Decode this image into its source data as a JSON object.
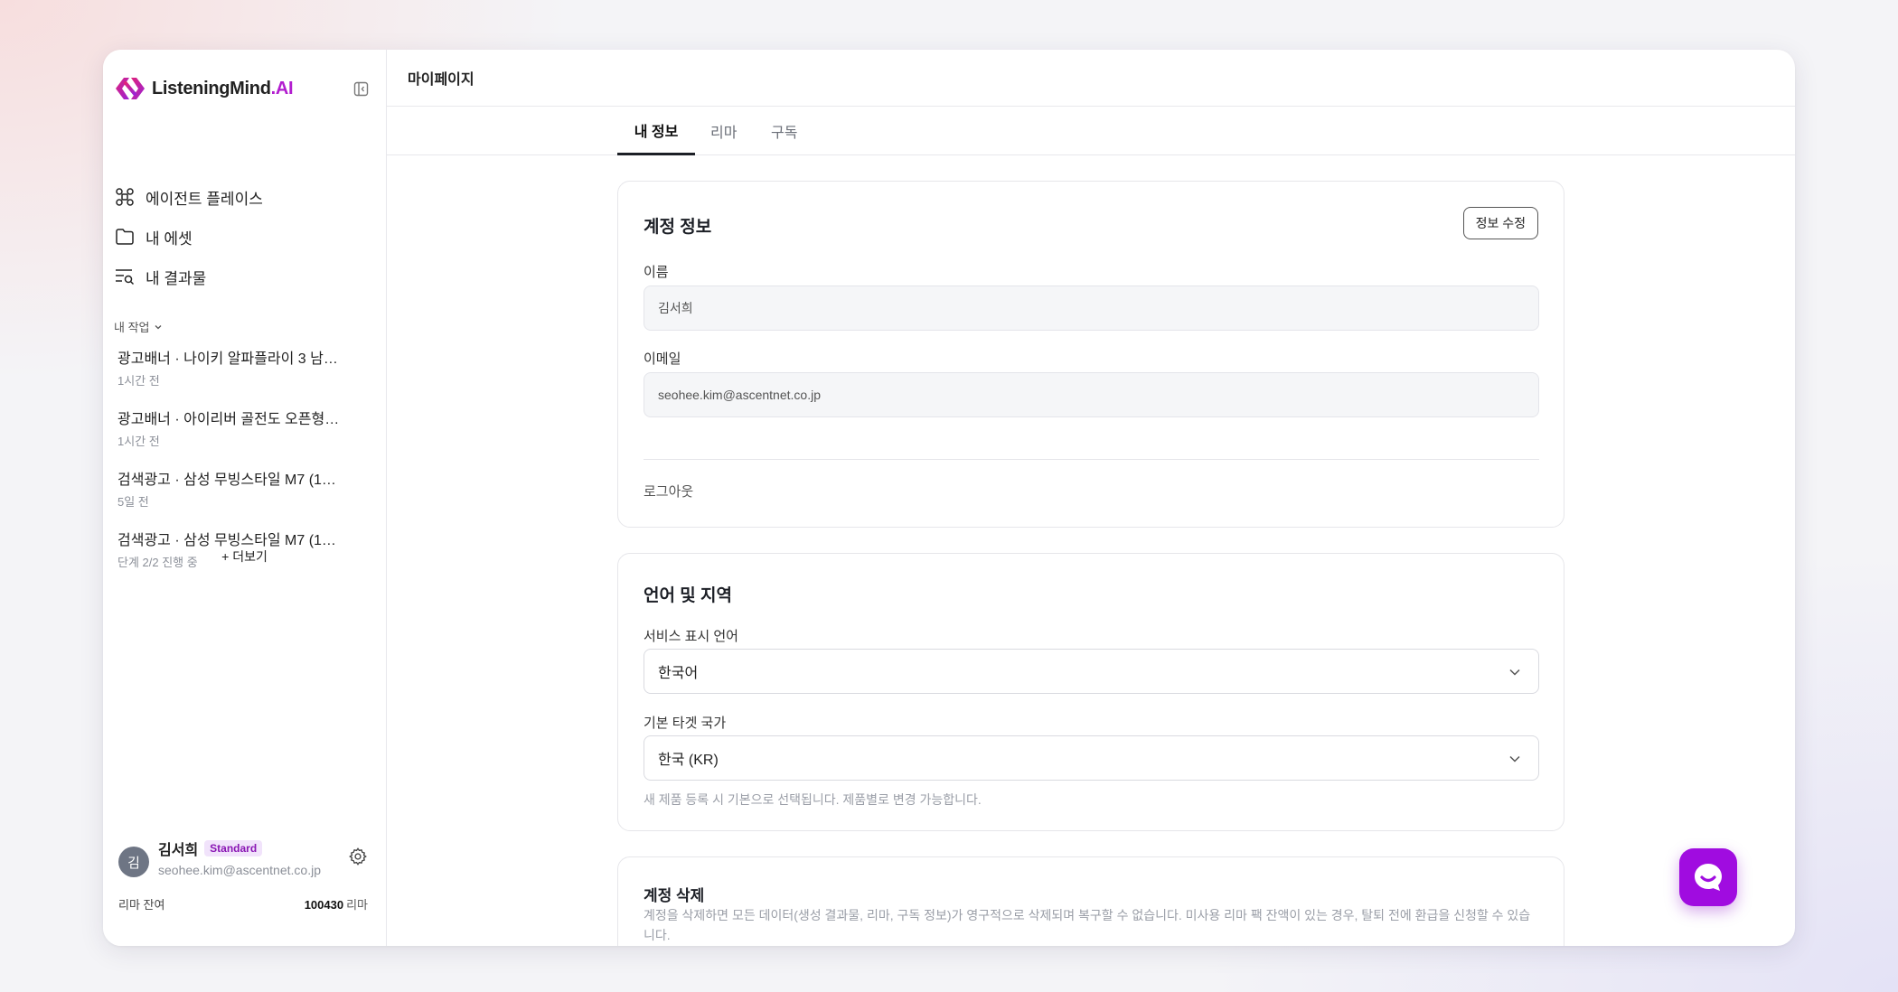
{
  "brand": {
    "name": "ListeningMind",
    "suffix": ".AI",
    "accent_color": "#b21ccf"
  },
  "sidebar": {
    "nav": [
      {
        "label": "에이전트 플레이스",
        "icon": "agent-grid-icon"
      },
      {
        "label": "내 에셋",
        "icon": "folder-icon"
      },
      {
        "label": "내 결과물",
        "icon": "results-list-icon"
      }
    ],
    "section_label": "내 작업",
    "tasks": [
      {
        "title": "광고배너 · 나이키 알파플라이 3 남…",
        "sub": "1시간 전"
      },
      {
        "title": "광고배너 · 아이리버 골전도 오픈형…",
        "sub": "1시간 전"
      },
      {
        "title": "검색광고 · 삼성 무빙스타일 M7 (1…",
        "sub": "5일 전"
      },
      {
        "title": "검색광고 · 삼성 무빙스타일 M7 (1…",
        "sub": "단계 2/2 진행 중"
      }
    ],
    "more_label": "+ 더보기",
    "user": {
      "avatar_initial": "김",
      "name": "김서희",
      "plan": "Standard",
      "email": "seohee.kim@ascentnet.co.jp",
      "balance_label": "리마 잔여",
      "balance_value": "100430",
      "balance_unit": "리마"
    }
  },
  "topbar": {
    "title": "마이페이지"
  },
  "tabs": [
    {
      "label": "내 정보",
      "active": true
    },
    {
      "label": "리마",
      "active": false
    },
    {
      "label": "구독",
      "active": false
    }
  ],
  "account": {
    "title": "계정 정보",
    "edit_label": "정보 수정",
    "name_label": "이름",
    "name_value": "김서희",
    "email_label": "이메일",
    "email_value": "seohee.kim@ascentnet.co.jp",
    "logout_label": "로그아웃"
  },
  "locale": {
    "title": "언어 및 지역",
    "language_label": "서비스 표시 언어",
    "language_value": "한국어",
    "country_label": "기본 타겟 국가",
    "country_value": "한국 (KR)",
    "country_hint": "새 제품 등록 시 기본으로 선택됩니다. 제품별로 변경 가능합니다."
  },
  "delete": {
    "title": "계정 삭제",
    "description": "계정을 삭제하면 모든 데이터(생성 결과물, 리마, 구독 정보)가 영구적으로 삭제되며 복구할 수 없습니다. 미사용 리마 팩 잔액이 있는 경우, 탈퇴 전에 환급을 신청할 수 있습니다."
  },
  "chat": {
    "icon": "chat-bubble-icon",
    "color": "#a00ce0"
  }
}
